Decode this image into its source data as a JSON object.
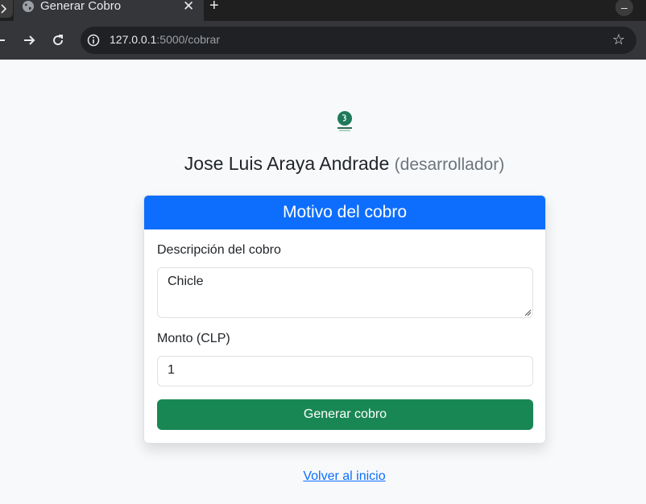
{
  "browser": {
    "tab_title": "Generar Cobro",
    "tab_close": "✕",
    "new_tab": "+",
    "tab_menu": "–",
    "url_host": "127.0.0.1",
    "url_path": ":5000/cobrar"
  },
  "page": {
    "user_name": "Jose Luis Araya Andrade",
    "user_role": "(desarrollador)"
  },
  "form": {
    "header": "Motivo del cobro",
    "description_label": "Descripción del cobro",
    "description_value": "Chicle",
    "amount_label": "Monto (CLP)",
    "amount_value": "1",
    "submit_label": "Generar cobro"
  },
  "footer": {
    "back_link": "Volver al inicio"
  },
  "colors": {
    "primary": "#0d6efd",
    "success": "#198754",
    "background": "#f8f9fa"
  }
}
